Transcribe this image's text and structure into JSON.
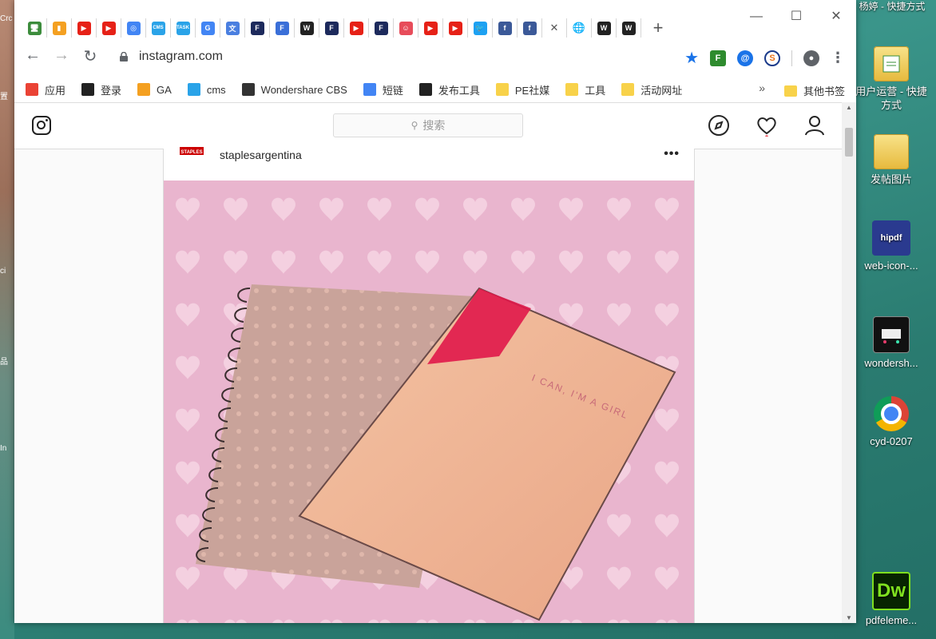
{
  "desktop": {
    "partial_labels": [
      "Crc",
      "置",
      "ci",
      "品",
      "In"
    ],
    "top_item": "杨婷 - 快捷方式",
    "icons": [
      {
        "label": "用户运营 - 快捷方式",
        "icon": "folder-shortcut-icon"
      },
      {
        "label": "发帖图片",
        "icon": "folder-icon"
      },
      {
        "label": "web-icon-...",
        "icon": "hipdf-file-icon",
        "thumb_text": "hipdf"
      },
      {
        "label": "wondersh...",
        "icon": "image-file-icon"
      },
      {
        "label": "cyd-0207",
        "icon": "chrome-icon"
      },
      {
        "label": "pdfeleme...",
        "icon": "dreamweaver-icon",
        "thumb_text": "Dw"
      }
    ]
  },
  "browser": {
    "tabs": [
      {
        "icon": "monitor-icon",
        "color": "#3c8c3c",
        "glyph": "🖥"
      },
      {
        "icon": "analytics-icon",
        "color": "#f4a021",
        "glyph": "▮"
      },
      {
        "icon": "youtube-icon",
        "color": "#e62117",
        "glyph": "▶"
      },
      {
        "icon": "youtube-icon",
        "color": "#e62117",
        "glyph": "▶"
      },
      {
        "icon": "chrome-web-icon",
        "color": "#4285f4",
        "glyph": "◎"
      },
      {
        "icon": "cms-icon",
        "color": "#2aa3e8",
        "glyph": "CMS"
      },
      {
        "icon": "task-icon",
        "color": "#2aa3e8",
        "glyph": "TASK"
      },
      {
        "icon": "google-icon",
        "color": "#4285f4",
        "glyph": "G"
      },
      {
        "icon": "translate-icon",
        "color": "#4a7fe0",
        "glyph": "文"
      },
      {
        "icon": "f-logo-icon",
        "color": "#1d2a5c",
        "glyph": "F"
      },
      {
        "icon": "f-logo-icon",
        "color": "#3a6fd8",
        "glyph": "F"
      },
      {
        "icon": "wondershare-icon",
        "color": "#222222",
        "glyph": "W"
      },
      {
        "icon": "f-logo-icon",
        "color": "#1d2a5c",
        "glyph": "F"
      },
      {
        "icon": "youtube-icon",
        "color": "#e62117",
        "glyph": "▶"
      },
      {
        "icon": "f-logo-icon",
        "color": "#1d2a5c",
        "glyph": "F"
      },
      {
        "icon": "smiley-icon",
        "color": "#e74c5a",
        "glyph": "☺"
      },
      {
        "icon": "youtube-icon",
        "color": "#e62117",
        "glyph": "▶"
      },
      {
        "icon": "youtube-icon",
        "color": "#e62117",
        "glyph": "▶"
      },
      {
        "icon": "twitter-icon",
        "color": "#1da1f2",
        "glyph": "🐦"
      },
      {
        "icon": "facebook-icon",
        "color": "#3b5998",
        "glyph": "f"
      },
      {
        "icon": "facebook-icon",
        "color": "#3b5998",
        "glyph": "f"
      },
      {
        "icon": "close-tab-icon",
        "color": "#555555",
        "glyph": "✕"
      },
      {
        "icon": "globe-icon",
        "color": "#555555",
        "glyph": "🌐"
      },
      {
        "icon": "wondershare-icon",
        "color": "#222222",
        "glyph": "W"
      },
      {
        "icon": "wondershare-icon",
        "color": "#222222",
        "glyph": "W"
      }
    ],
    "new_tab": "+",
    "url": "instagram.com",
    "bookmarks": [
      {
        "label": "应用",
        "icon": "apps-grid-icon",
        "color": "#ea4335"
      },
      {
        "label": "登录",
        "icon": "wondershare-icon",
        "color": "#222222"
      },
      {
        "label": "GA",
        "icon": "analytics-icon",
        "color": "#f4a021"
      },
      {
        "label": "cms",
        "icon": "cms-icon",
        "color": "#2aa3e8"
      },
      {
        "label": "Wondershare CBS",
        "icon": "cbs-icon",
        "color": "#333333"
      },
      {
        "label": "短链",
        "icon": "chrome-web-icon",
        "color": "#4285f4"
      },
      {
        "label": "发布工具",
        "icon": "wondershare-icon",
        "color": "#222222"
      },
      {
        "label": "PE社媒",
        "icon": "folder-icon",
        "color": "#f8d24a"
      },
      {
        "label": "工具",
        "icon": "folder-icon",
        "color": "#f8d24a"
      },
      {
        "label": "活动网址",
        "icon": "folder-icon",
        "color": "#f8d24a"
      }
    ],
    "bookmarks_more": "»",
    "other_bookmarks": "其他书签"
  },
  "instagram": {
    "search_placeholder": "搜索",
    "post": {
      "username": "staplesargentina",
      "avatar_text": "STAPLES",
      "more": "•••",
      "notebook_text": "I CAN, I'M A GIRL"
    }
  },
  "colors": {
    "image_bg": "#e9b5ce",
    "heart": "#f6d6e4",
    "notebook_front": "#f0b394",
    "notebook_back": "#c9a39a",
    "accent_red": "#e0184a"
  }
}
